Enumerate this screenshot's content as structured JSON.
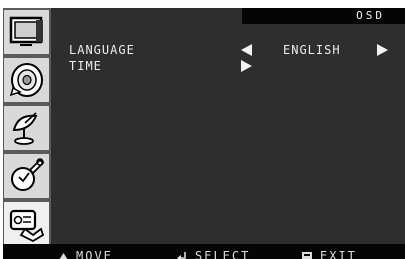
{
  "osd": {
    "title": "OSD",
    "sidebar": [
      {
        "name": "picture",
        "icon": "tv-screen-icon",
        "selected": false
      },
      {
        "name": "sound",
        "icon": "speaker-cone-icon",
        "selected": false
      },
      {
        "name": "channel",
        "icon": "satellite-dish-icon",
        "selected": false
      },
      {
        "name": "setup",
        "icon": "tools-icon",
        "selected": false
      },
      {
        "name": "osd",
        "icon": "osd-settings-icon",
        "selected": true
      }
    ],
    "rows": [
      {
        "label": "LANGUAGE",
        "value": "ENGLISH"
      },
      {
        "label": "TIME",
        "value": ""
      }
    ],
    "footer": {
      "move": "MOVE",
      "select": "SELECT",
      "exit": "EXIT"
    }
  },
  "colors": {
    "panel_bg": "#2e2e2e",
    "sidebar_bg": "#5a5a5a",
    "tile_bg": "#d9d9d9",
    "bar_bg": "#050505",
    "text": "#ececec"
  }
}
